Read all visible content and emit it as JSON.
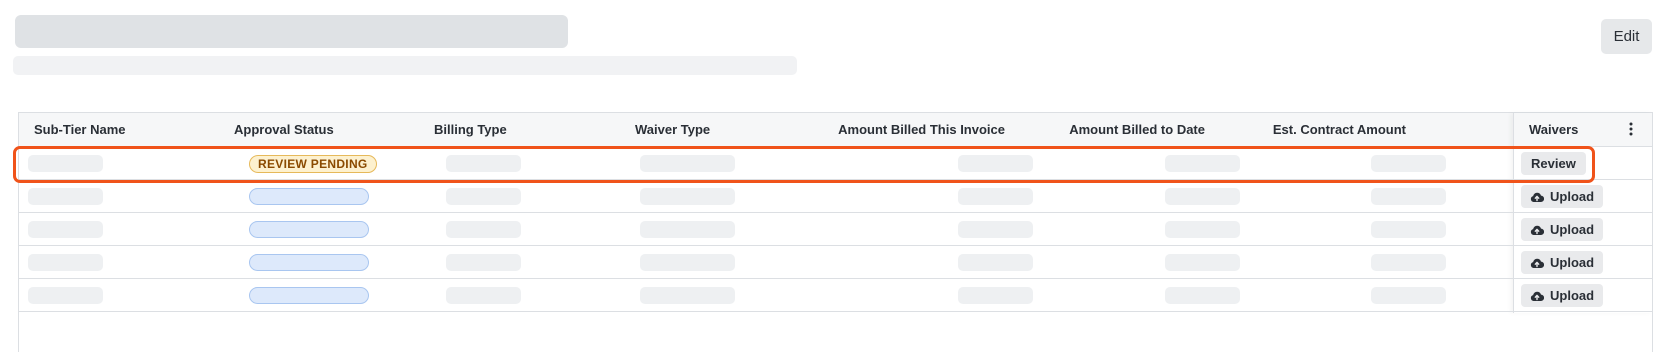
{
  "header": {
    "edit_label": "Edit"
  },
  "table": {
    "columns": [
      "Sub-Tier Name",
      "Approval Status",
      "Billing Type",
      "Waiver Type",
      "Amount Billed This Invoice",
      "Amount Billed to Date",
      "Est. Contract Amount",
      "Waivers"
    ],
    "rows": [
      {
        "status": "REVIEW PENDING",
        "action": "Review",
        "action_icon": ""
      },
      {
        "status": "",
        "action": "Upload",
        "action_icon": "cloud-upload-icon"
      },
      {
        "status": "",
        "action": "Upload",
        "action_icon": "cloud-upload-icon"
      },
      {
        "status": "",
        "action": "Upload",
        "action_icon": "cloud-upload-icon"
      },
      {
        "status": "",
        "action": "Upload",
        "action_icon": "cloud-upload-icon"
      }
    ]
  },
  "colors": {
    "highlight": "#f0531a",
    "review_badge_bg": "#fdf1cf",
    "review_badge_text": "#8a4a00",
    "status_placeholder": "#dde9fb"
  }
}
